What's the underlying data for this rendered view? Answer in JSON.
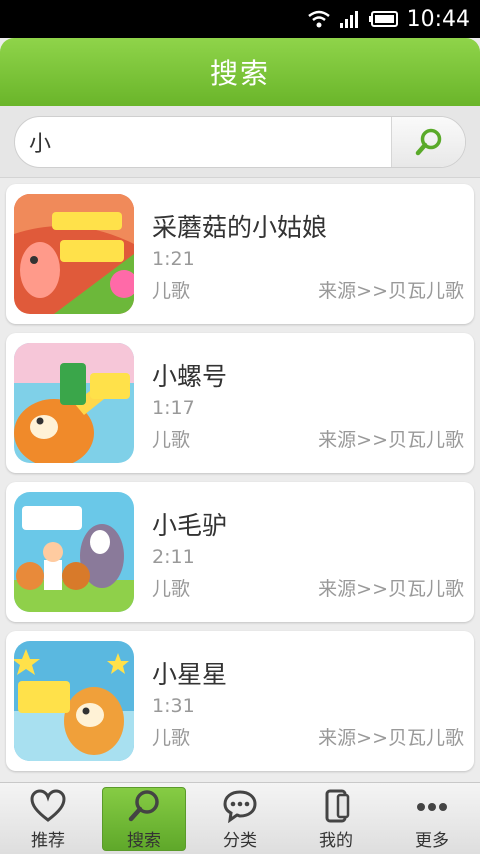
{
  "status_bar": {
    "time": "10:44"
  },
  "header": {
    "title": "搜索"
  },
  "search": {
    "value": "小"
  },
  "results": [
    {
      "title": "采蘑菇的小姑娘",
      "duration": "1:21",
      "category": "儿歌",
      "source": "来源>>贝瓦儿歌"
    },
    {
      "title": "小螺号",
      "duration": "1:17",
      "category": "儿歌",
      "source": "来源>>贝瓦儿歌"
    },
    {
      "title": "小毛驴",
      "duration": "2:11",
      "category": "儿歌",
      "source": "来源>>贝瓦儿歌"
    },
    {
      "title": "小星星",
      "duration": "1:31",
      "category": "儿歌",
      "source": "来源>>贝瓦儿歌"
    }
  ],
  "tabs": [
    {
      "label": "推荐",
      "icon": "heart-icon"
    },
    {
      "label": "搜索",
      "icon": "search-icon",
      "active": true
    },
    {
      "label": "分类",
      "icon": "chat-bubble-icon"
    },
    {
      "label": "我的",
      "icon": "phone-icon"
    },
    {
      "label": "更多",
      "icon": "more-dots-icon"
    }
  ],
  "colors": {
    "accent": "#7cc33a",
    "text": "#333333",
    "muted": "#999999"
  }
}
